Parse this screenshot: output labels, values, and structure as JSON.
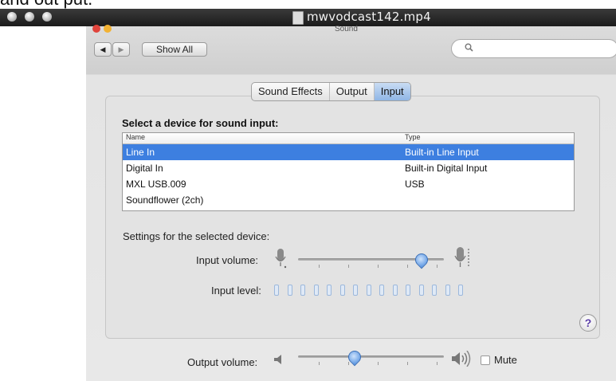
{
  "caption": {
    "text": "and out put."
  },
  "player": {
    "title": "mwvodcast142.mp4"
  },
  "window": {
    "title": "Sound",
    "show_all": "Show All",
    "nav_back": "◀",
    "nav_forward": "▶"
  },
  "tabs": [
    {
      "label": "Sound Effects",
      "active": false
    },
    {
      "label": "Output",
      "active": false
    },
    {
      "label": "Input",
      "active": true
    }
  ],
  "input": {
    "heading": "Select a device for sound input:",
    "columns": [
      "Name",
      "Type"
    ],
    "devices": [
      {
        "name": "Line In",
        "type": "Built-in Line Input",
        "selected": true
      },
      {
        "name": "Digital In",
        "type": "Built-in Digital Input",
        "selected": false
      },
      {
        "name": "MXL USB.009",
        "type": "USB",
        "selected": false
      },
      {
        "name": "Soundflower (2ch)",
        "type": "",
        "selected": false
      }
    ],
    "settings_label": "Settings for the selected device:",
    "input_volume_label": "Input volume:",
    "input_volume_value": 0.88,
    "input_level_label": "Input level:",
    "input_level_segments": 15,
    "input_level_lit": 0
  },
  "help_label": "?",
  "output": {
    "volume_label": "Output volume:",
    "volume_value": 0.38,
    "mute_label": "Mute",
    "muted": false
  },
  "colors": {
    "selection": "#3d7fe0",
    "accent": "#4f8fe0"
  }
}
